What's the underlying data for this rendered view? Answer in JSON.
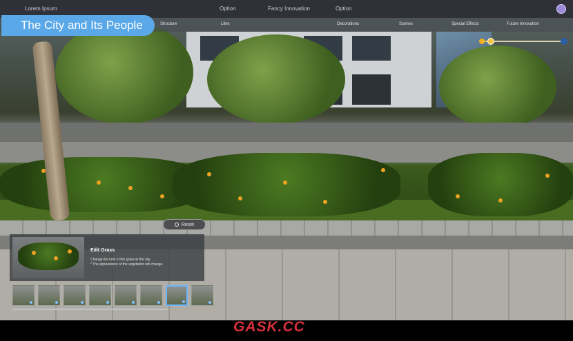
{
  "header": {
    "title": "The City and Its People",
    "menu": [
      "Lorem Ipsum",
      "Option",
      "Fancy Innovation",
      "Option"
    ]
  },
  "nav": {
    "tabs": [
      "Structure",
      "Lites",
      "Decorations",
      "Scenes",
      "Special Effects",
      "Future Innovation"
    ]
  },
  "time_slider": {
    "value": 0.1
  },
  "edit_panel": {
    "reset_label": "Reset",
    "heading": "Edit Grass",
    "description_line1": "Change the look of the grass in the city.",
    "description_line2": "* The appearance of the vegetation will change."
  },
  "variants": {
    "count": 8,
    "selected_index": 6
  },
  "watermark": "GASK.CC",
  "colors": {
    "accent": "#5aa8e8",
    "selection": "#6fb6ff",
    "watermark": "#d8303a"
  }
}
